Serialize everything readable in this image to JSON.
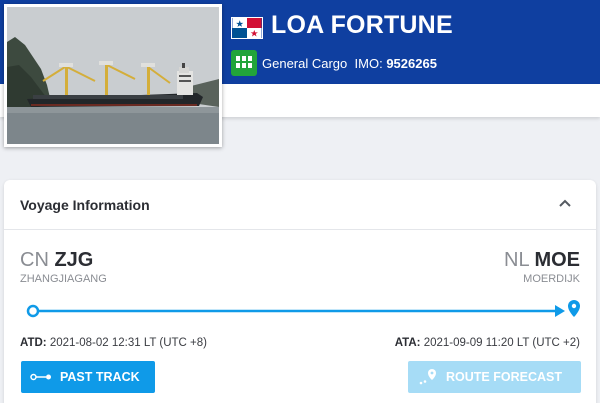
{
  "vessel": {
    "name": "LOA FORTUNE",
    "flag_icon": "panama-flag-icon",
    "type_icon": "general-cargo-icon",
    "type": "General Cargo",
    "imo_label": "IMO:",
    "imo": "9526265"
  },
  "voyage": {
    "title": "Voyage Information",
    "origin": {
      "country": "CN",
      "port": "ZJG",
      "name": "ZHANGJIAGANG"
    },
    "destination": {
      "country": "NL",
      "port": "MOE",
      "name": "MOERDIJK"
    },
    "atd_label": "ATD:",
    "atd": "2021-08-02 12:31 LT (UTC +8)",
    "ata_label": "ATA:",
    "ata": "2021-09-09 11:20 LT (UTC +2)",
    "progress": 1.0,
    "buttons": {
      "past_track": "PAST TRACK",
      "route_forecast": "ROUTE FORECAST"
    }
  },
  "colors": {
    "header_bg": "#0f3fa0",
    "accent": "#0f9ae8",
    "cargo_green": "#22a43a",
    "disabled_button": "#a6dcf6"
  }
}
